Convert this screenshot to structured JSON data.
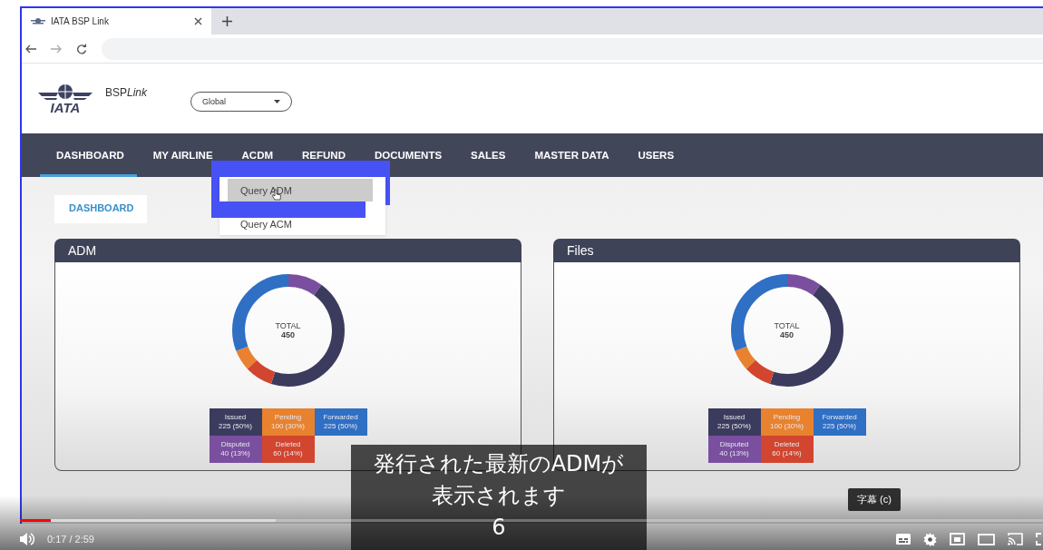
{
  "browser": {
    "tab_title": "IATA BSP Link"
  },
  "app": {
    "logo_text": "IATA",
    "product_name": "BSP",
    "product_name_italic": "Link",
    "region_select": {
      "value": "Global"
    }
  },
  "nav": [
    {
      "label": "DASHBOARD",
      "selected": true
    },
    {
      "label": "MY AIRLINE",
      "selected": false
    },
    {
      "label": "ACDM",
      "selected": false
    },
    {
      "label": "REFUND",
      "selected": false
    },
    {
      "label": "DOCUMENTS",
      "selected": false
    },
    {
      "label": "SALES",
      "selected": false
    },
    {
      "label": "MASTER DATA",
      "selected": false
    },
    {
      "label": "USERS",
      "selected": false
    }
  ],
  "dropdown": [
    {
      "label": "Query ADM",
      "selected": true
    },
    {
      "label": "Query ACM",
      "selected": false
    }
  ],
  "page_tab": "DASHBOARD",
  "cards": [
    {
      "title": "ADM",
      "center_label": "TOTAL",
      "center_value": "450",
      "legend": [
        {
          "label": "Issued",
          "value": "225 (50%)",
          "color": "#3b3b5e"
        },
        {
          "label": "Pending",
          "value": "100 (30%)",
          "color": "#e8822f"
        },
        {
          "label": "Forwarded",
          "value": "225 (50%)",
          "color": "#2f6fc4"
        },
        {
          "label": "Disputed",
          "value": "40 (13%)",
          "color": "#7a4f9f"
        },
        {
          "label": "Deleted",
          "value": "60 (14%)",
          "color": "#d2452f"
        }
      ]
    },
    {
      "title": "Files",
      "center_label": "TOTAL",
      "center_value": "450",
      "legend": [
        {
          "label": "Issued",
          "value": "225 (50%)",
          "color": "#3b3b5e"
        },
        {
          "label": "Pending",
          "value": "100 (30%)",
          "color": "#e8822f"
        },
        {
          "label": "Forwarded",
          "value": "225 (50%)",
          "color": "#2f6fc4"
        },
        {
          "label": "Disputed",
          "value": "40 (13%)",
          "color": "#7a4f9f"
        },
        {
          "label": "Deleted",
          "value": "60 (14%)",
          "color": "#d2452f"
        }
      ]
    }
  ],
  "subtitle": {
    "lines": [
      "発行された最新のADMが",
      "表示されます",
      "6"
    ]
  },
  "tooltip": "字幕 (c)",
  "player": {
    "time": "0:17 / 2:59",
    "progress": {
      "level": 0.03
    },
    "buffered": {
      "level": 0.25
    }
  }
}
